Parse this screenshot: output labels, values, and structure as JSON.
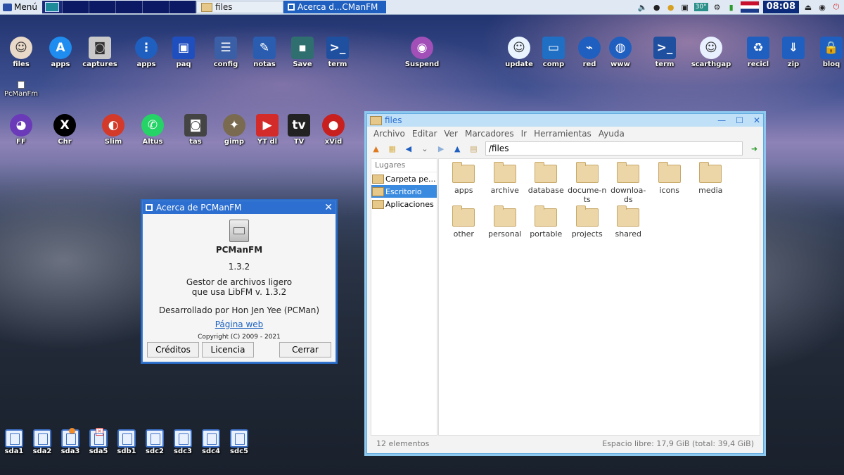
{
  "taskbar": {
    "menu_label": "Menú",
    "tasks": [
      "files",
      "Acerca d...CManFM"
    ],
    "tray_temp": "30°",
    "clock": "08:08"
  },
  "desktop_icons_row1": [
    {
      "label": "files",
      "icon": "face-icon",
      "color": "#e9d9c8"
    },
    {
      "label": "apps",
      "icon": "app-store-icon",
      "color": "#1f8cf0"
    },
    {
      "label": "captures",
      "icon": "camera-icon",
      "color": "#c9c9c9"
    },
    {
      "label": "apps",
      "icon": "grid-icon",
      "color": "#1f5fbf"
    },
    {
      "label": "paq",
      "icon": "package-icon",
      "color": "#1f4fbf"
    },
    {
      "label": "config",
      "icon": "sliders-icon",
      "color": "#3b5fa6"
    },
    {
      "label": "notas",
      "icon": "notes-icon",
      "color": "#2a5db0"
    },
    {
      "label": "Save",
      "icon": "floppy-icon",
      "color": "#2f6f6f"
    },
    {
      "label": "term",
      "icon": "terminal-icon",
      "color": "#1f4f9f"
    },
    {
      "label": "Suspend",
      "icon": "power-icon",
      "color": "#a24fb8"
    },
    {
      "label": "update",
      "icon": "update-icon",
      "color": "#e9f4ff"
    },
    {
      "label": "comp",
      "icon": "computer-icon",
      "color": "#1f6fc4"
    },
    {
      "label": "red",
      "icon": "network-icon",
      "color": "#1f5fbf"
    },
    {
      "label": "www",
      "icon": "globe-icon",
      "color": "#1f5fbf"
    },
    {
      "label": "term",
      "icon": "terminal-icon",
      "color": "#1f4f9f"
    },
    {
      "label": "scarthgap",
      "icon": "puppy-icon",
      "color": "#e9f0ff"
    },
    {
      "label": "recicl",
      "icon": "recycle-icon",
      "color": "#1f5fbf"
    },
    {
      "label": "zip",
      "icon": "zip-icon",
      "color": "#1f5fbf"
    },
    {
      "label": "bloq",
      "icon": "lock-icon",
      "color": "#1f5fbf"
    }
  ],
  "pcmanfm_label": "PcManFm",
  "desktop_icons_row2": [
    {
      "label": "FF",
      "icon": "firefox-icon",
      "color": "#6a3ab8"
    },
    {
      "label": "Chr",
      "icon": "x-icon",
      "color": "#000000"
    },
    {
      "label": "Slim",
      "icon": "slimjet-icon",
      "color": "#d33a2a"
    },
    {
      "label": "Altus",
      "icon": "whatsapp-icon",
      "color": "#25d366"
    },
    {
      "label": "tas",
      "icon": "camera-icon",
      "color": "#444444"
    },
    {
      "label": "gimp",
      "icon": "gimp-icon",
      "color": "#7a6a50"
    },
    {
      "label": "YT dl",
      "icon": "youtube-icon",
      "color": "#d32a2a"
    },
    {
      "label": "TV",
      "icon": "tv-icon",
      "color": "#222222"
    },
    {
      "label": "xVid",
      "icon": "record-icon",
      "color": "#c8201f"
    }
  ],
  "drives": [
    "sda1",
    "sda2",
    "sda3",
    "sda5",
    "sdb1",
    "sdc2",
    "sdc3",
    "sdc4",
    "sdc5"
  ],
  "about": {
    "title": "Acerca de PCManFM",
    "app_name": "PCManFM",
    "version": "1.3.2",
    "desc_line1": "Gestor de archivos ligero",
    "desc_line2": "que usa LibFM v. 1.3.2",
    "developer": "Desarrollado por Hon Jen Yee (PCMan)",
    "website": "Página web",
    "copyright": "Copyright (C) 2009 - 2021",
    "buttons": {
      "credits": "Créditos",
      "license": "Licencia",
      "close": "Cerrar"
    }
  },
  "fm": {
    "title": "files",
    "menu": [
      "Archivo",
      "Editar",
      "Ver",
      "Marcadores",
      "Ir",
      "Herramientas",
      "Ayuda"
    ],
    "path": "/files",
    "places_header": "Lugares",
    "places": [
      "Carpeta pe...",
      "Escritorio",
      "Aplicaciones"
    ],
    "items": [
      "apps",
      "archive",
      "database",
      "docume-nts",
      "downloa-ds",
      "icons",
      "media",
      "other",
      "personal",
      "portable",
      "projects",
      "shared"
    ],
    "status_count": "12 elementos",
    "status_free": "Espacio libre: 17,9 GiB (total: 39,4 GiB)"
  }
}
